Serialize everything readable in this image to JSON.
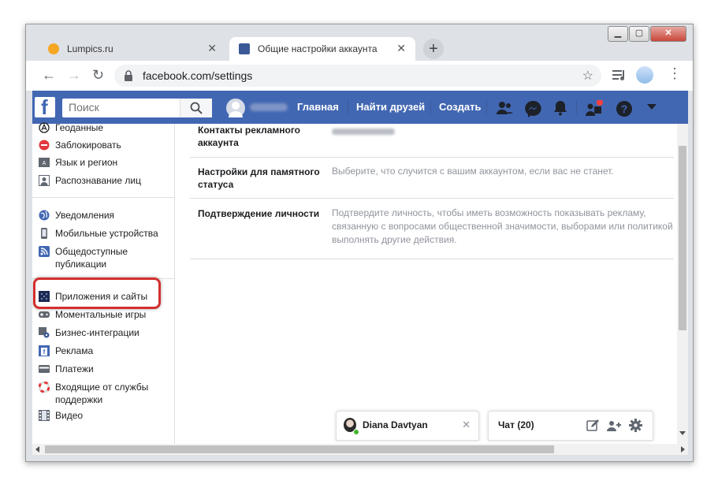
{
  "browser": {
    "tabs": [
      {
        "title": "Lumpics.ru",
        "favicon_color": "#f5a623"
      },
      {
        "title": "Общие настройки аккаунта",
        "favicon_color": "#3b5998"
      }
    ],
    "url": "facebook.com/settings",
    "new_tab_symbol": "+",
    "close_symbol": "✕"
  },
  "facebook": {
    "search_placeholder": "Поиск",
    "nav": {
      "home": "Главная",
      "find_friends": "Найти друзей",
      "create": "Создать"
    },
    "brand_color": "#4267b2"
  },
  "sidebar": {
    "group1": [
      {
        "label": "Геоданные",
        "icon": "location-icon"
      },
      {
        "label": "Заблокировать",
        "icon": "block-icon"
      },
      {
        "label": "Язык и регион",
        "icon": "language-icon"
      },
      {
        "label": "Распознавание лиц",
        "icon": "face-recognition-icon"
      }
    ],
    "group2": [
      {
        "label": "Уведомления",
        "icon": "globe-icon"
      },
      {
        "label": "Мобильные устройства",
        "icon": "mobile-icon"
      },
      {
        "label": "Общедоступные публикации",
        "icon": "rss-icon"
      }
    ],
    "group3": [
      {
        "label": "Приложения и сайты",
        "icon": "apps-icon"
      },
      {
        "label": "Моментальные игры",
        "icon": "gamepad-icon"
      },
      {
        "label": "Бизнес-интеграции",
        "icon": "business-icon"
      },
      {
        "label": "Реклама",
        "icon": "ads-icon"
      },
      {
        "label": "Платежи",
        "icon": "card-icon"
      },
      {
        "label": "Входящие от службы поддержки",
        "icon": "lifebuoy-icon"
      },
      {
        "label": "Видео",
        "icon": "film-icon"
      }
    ]
  },
  "settings": [
    {
      "label": "Контакты рекламного аккаунта",
      "value": ""
    },
    {
      "label": "Настройки для памятного статуса",
      "value": "Выберите, что случится с вашим аккаунтом, если вас не станет."
    },
    {
      "label": "Подтверждение личности",
      "value": "Подтвердите личность, чтобы иметь возможность показывать рекламу, связанную с вопросами общественной значимости, выборами или политикой выполнять другие действия."
    }
  ],
  "chat": {
    "contact_name": "Diana Davtyan",
    "chat_label": "Чат (20)"
  }
}
